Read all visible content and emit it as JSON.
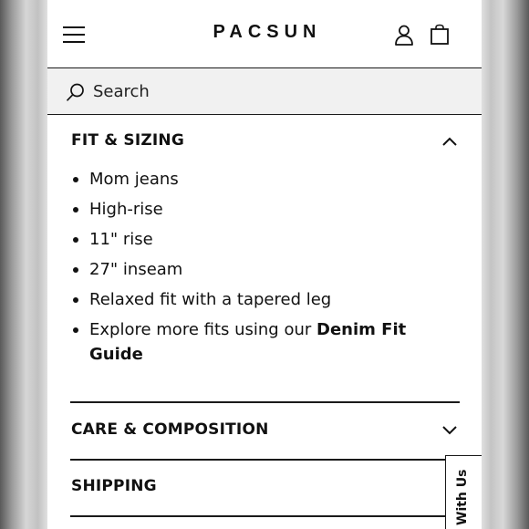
{
  "header": {
    "logo": "PACSUN",
    "menu_icon": "hamburger-menu-icon",
    "account_icon": "user-icon",
    "cart_icon": "shopping-bag-icon"
  },
  "search": {
    "placeholder": "Search",
    "icon": "search-icon"
  },
  "accordion": {
    "fit_sizing": {
      "title": "FIT & SIZING",
      "expanded": true,
      "items": [
        "Mom jeans",
        "High-rise",
        "11\" rise",
        "27\" inseam",
        "Relaxed fit with a tapered leg"
      ],
      "explore_prefix": "Explore more fits using our ",
      "explore_link": "Denim Fit Guide"
    },
    "care": {
      "title": "CARE & COMPOSITION",
      "expanded": false
    },
    "shipping": {
      "title": "SHIPPING",
      "expanded": false
    }
  },
  "chat_tab": {
    "label": "With Us"
  }
}
